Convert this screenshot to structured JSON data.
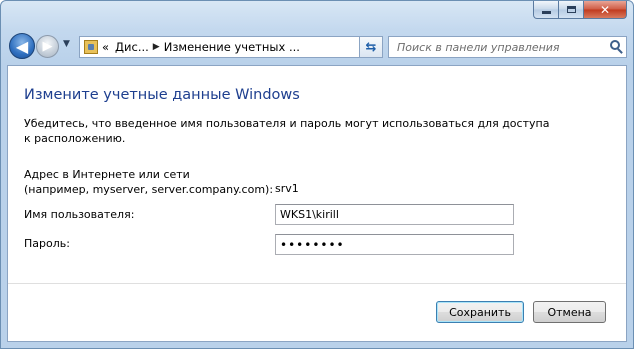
{
  "window": {
    "caption": {
      "minimize": "minimize",
      "maximize": "maximize",
      "close": "✕"
    }
  },
  "nav": {
    "back_glyph": "◀",
    "forward_glyph": "▶",
    "breadcrumbs": [
      "Дис...",
      "Изменение учетных ..."
    ],
    "breadcrumb_prefix": "«",
    "separator": "▶",
    "dropdown": "▼",
    "refresh": "⇆",
    "search_placeholder": "Поиск в панели управления"
  },
  "form": {
    "title": "Измените учетные данные Windows",
    "description": "Убедитесь, что введенное имя пользователя и пароль могут использоваться для доступа к расположению.",
    "address_label_1": "Адрес в Интернете или сети",
    "address_label_2": "(например, myserver, server.company.com):",
    "address_value": "srv1",
    "username_label": "Имя пользователя:",
    "username_value": "WKS1\\kirill",
    "password_label": "Пароль:",
    "password_value": "••••••••"
  },
  "buttons": {
    "save": "Сохранить",
    "cancel": "Отмена"
  }
}
